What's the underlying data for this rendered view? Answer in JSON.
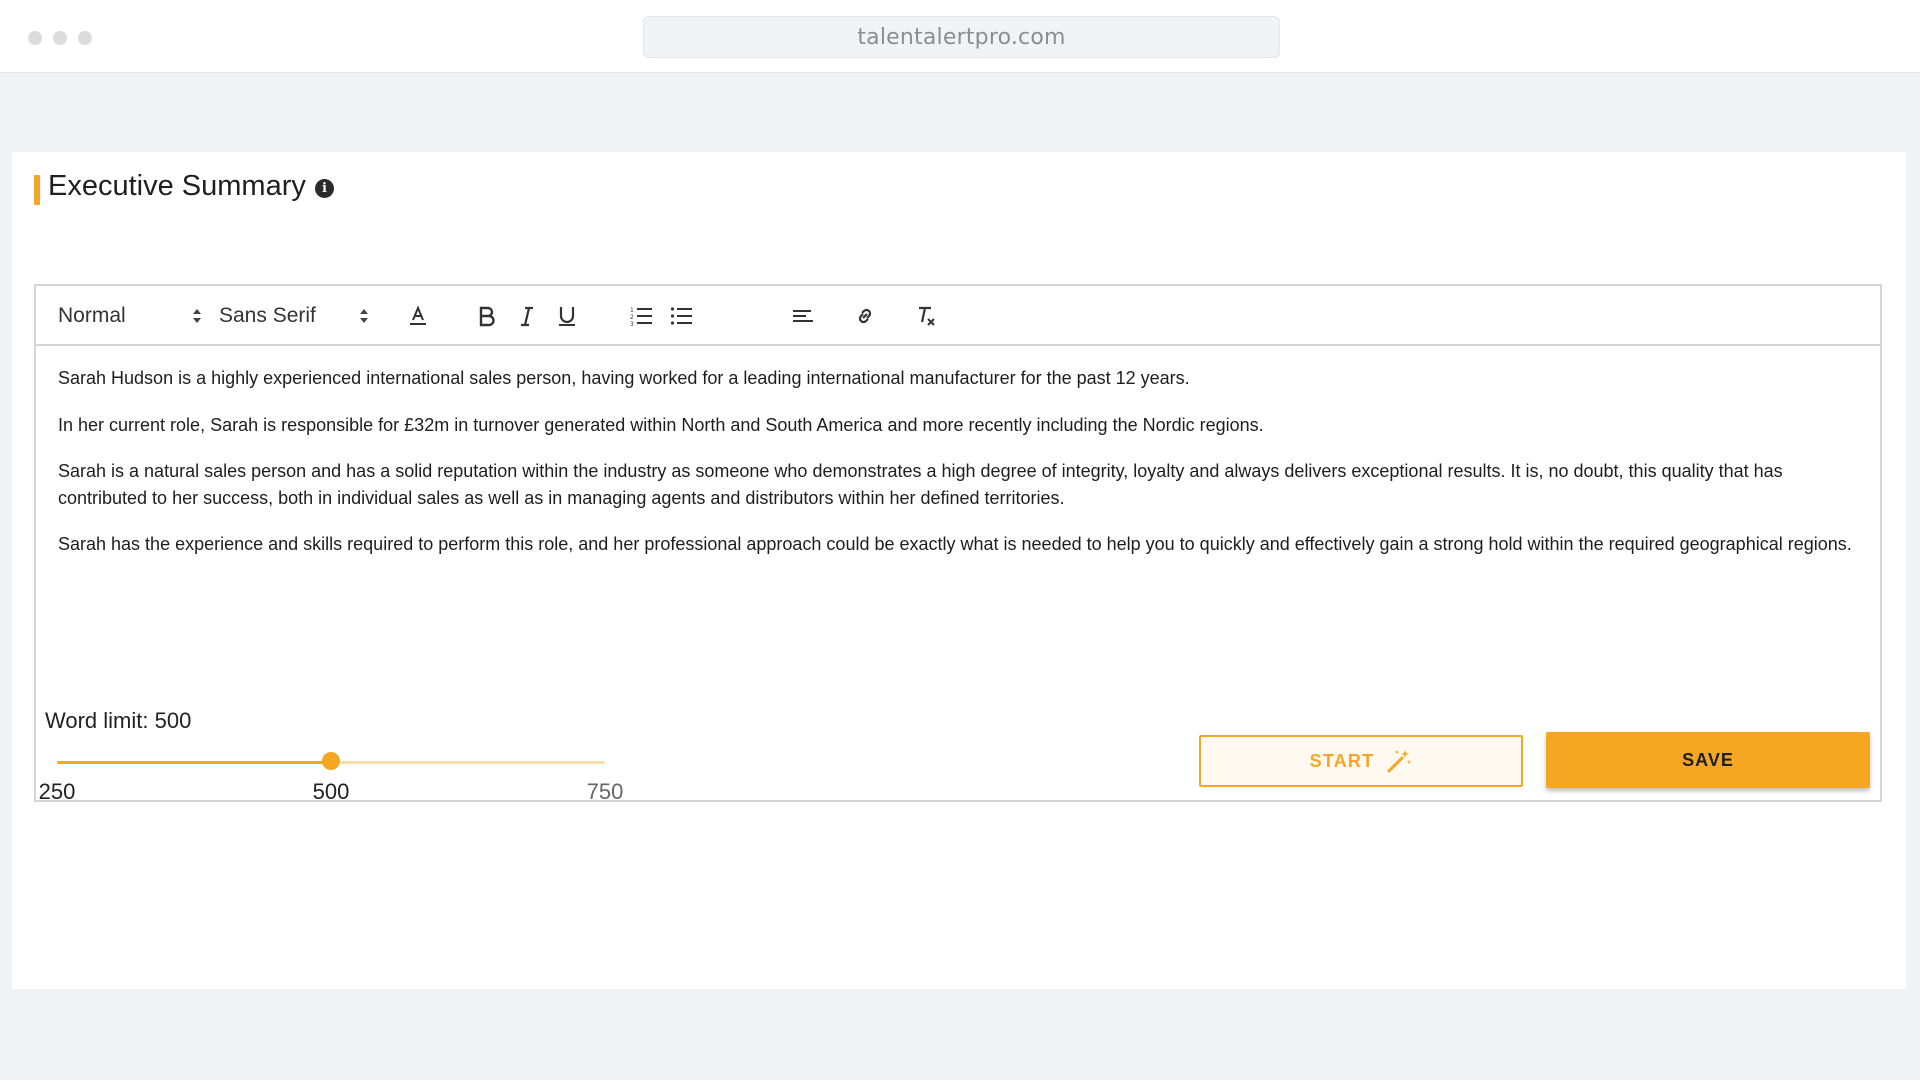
{
  "browser": {
    "url": "talentalertpro.com"
  },
  "section": {
    "title": "Executive Summary",
    "info_icon": "info-icon"
  },
  "toolbar": {
    "format_select": "Normal",
    "font_select": "Sans Serif",
    "icons": [
      "text-color-icon",
      "bold-icon",
      "italic-icon",
      "underline-icon",
      "ordered-list-icon",
      "bullet-list-icon",
      "align-icon",
      "link-icon",
      "clear-format-icon"
    ]
  },
  "editor": {
    "paragraphs": [
      "Sarah Hudson is a highly experienced international sales person, having worked for a leading international manufacturer for the past 12 years.",
      "In her current role, Sarah is responsible for £32m in turnover generated within North and South America and more recently including the Nordic regions.",
      "Sarah is a natural sales person and has a solid reputation within the industry as someone who demonstrates a high degree of integrity, loyalty and always delivers exceptional results. It is, no doubt, this quality that has contributed to her success, both in individual sales as well as in managing agents and distributors within her defined territories.",
      "Sarah has the experience and skills required to perform this role, and her professional approach could be exactly what is needed to help you to quickly and effectively gain a strong hold within the required geographical regions."
    ]
  },
  "word_limit": {
    "label": "Word limit: 500",
    "min": 250,
    "max": 750,
    "value": 500,
    "min_label": "250",
    "mid_label": "500",
    "max_label": "750"
  },
  "actions": {
    "start_label": "START",
    "save_label": "SAVE"
  },
  "colors": {
    "accent": "#f5a623",
    "accent_light": "#fff9ef",
    "background": "#f2f3f6"
  }
}
